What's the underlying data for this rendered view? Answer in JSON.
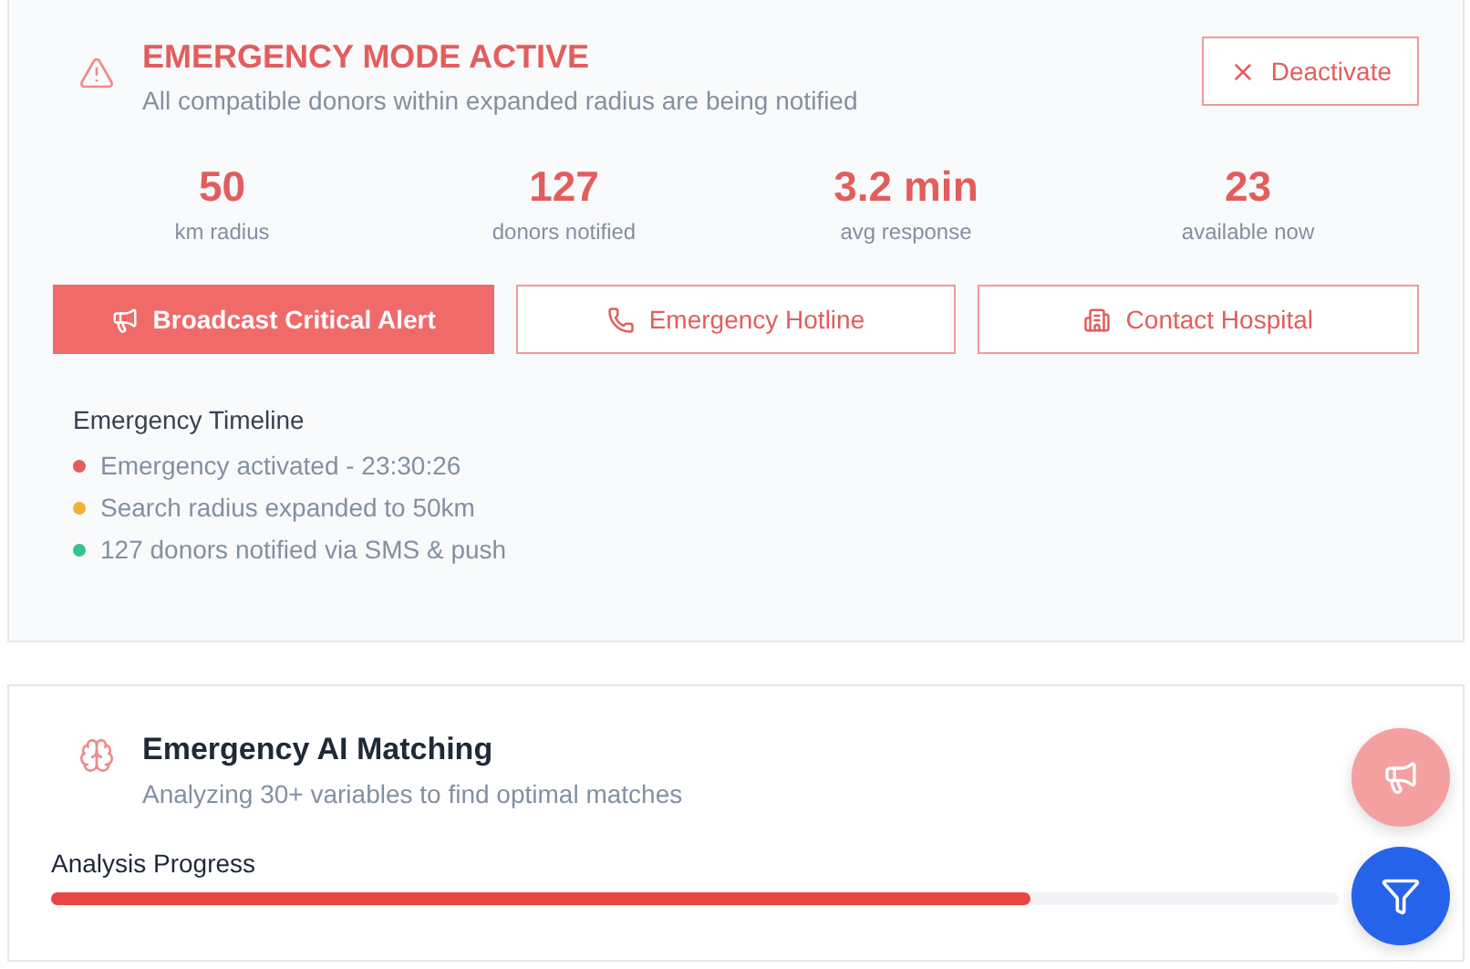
{
  "emergency": {
    "title": "EMERGENCY MODE ACTIVE",
    "subtitle": "All compatible donors within expanded radius are being notified",
    "deactivate": "Deactivate",
    "stats": [
      {
        "value": "50",
        "label": "km radius"
      },
      {
        "value": "127",
        "label": "donors notified"
      },
      {
        "value": "3.2 min",
        "label": "avg response"
      },
      {
        "value": "23",
        "label": "available now"
      }
    ],
    "actions": [
      {
        "kind": "broadcast",
        "label": "Broadcast Critical Alert",
        "primary": true
      },
      {
        "kind": "phone",
        "label": "Emergency Hotline",
        "primary": false
      },
      {
        "kind": "hospital",
        "label": "Contact Hospital",
        "primary": false
      }
    ],
    "timeline": {
      "title": "Emergency Timeline",
      "events": [
        {
          "text": "Emergency activated - 23:30:26",
          "color": "#e35d5d"
        },
        {
          "text": "Search radius expanded to 50km",
          "color": "#f2b035"
        },
        {
          "text": "127 donors notified via SMS & push",
          "color": "#34c38f"
        }
      ]
    }
  },
  "matching": {
    "title": "Emergency AI Matching",
    "subtitle": "Analyzing 30+ variables to find optimal matches",
    "progress": {
      "label": "Analysis Progress",
      "level": 0.76
    }
  },
  "fabs": [
    {
      "kind": "broadcast"
    },
    {
      "kind": "filter"
    }
  ]
}
